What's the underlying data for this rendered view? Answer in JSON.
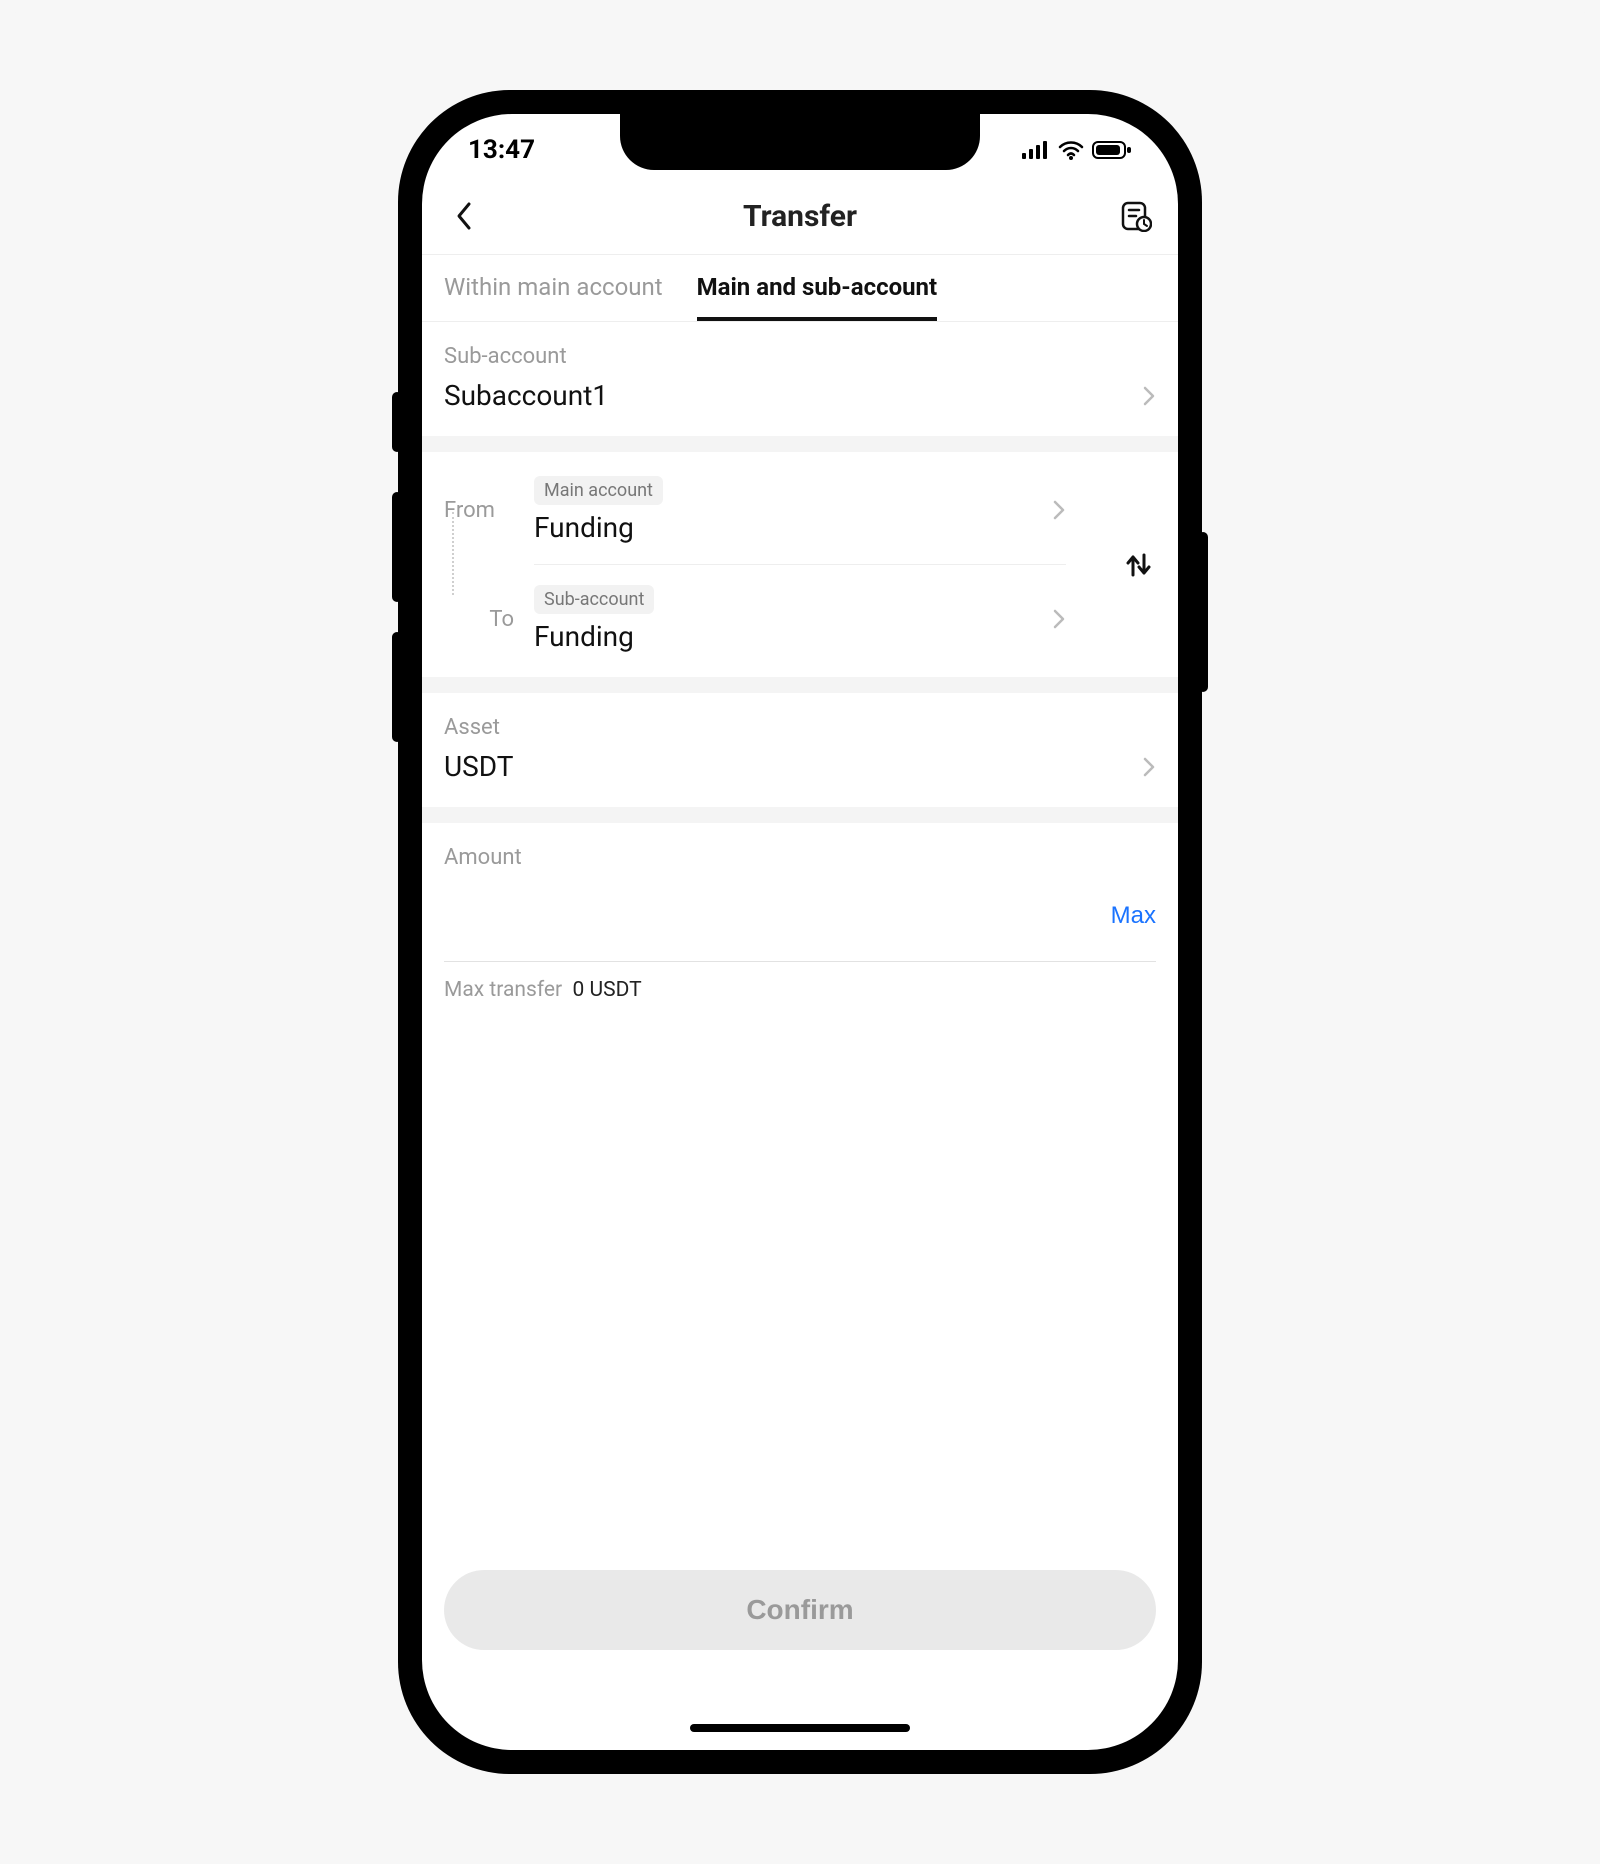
{
  "status": {
    "time": "13:47"
  },
  "header": {
    "title": "Transfer"
  },
  "tabs": {
    "within": "Within main account",
    "mainsub": "Main and sub-account"
  },
  "subaccount": {
    "label": "Sub-account",
    "value": "Subaccount1"
  },
  "transfer": {
    "from_label": "From",
    "from_badge": "Main account",
    "from_value": "Funding",
    "to_label": "To",
    "to_badge": "Sub-account",
    "to_value": "Funding"
  },
  "asset": {
    "label": "Asset",
    "value": "USDT"
  },
  "amount": {
    "label": "Amount",
    "max_btn": "Max",
    "max_transfer_label": "Max transfer",
    "max_transfer_value": "0 USDT"
  },
  "confirm": {
    "label": "Confirm"
  }
}
